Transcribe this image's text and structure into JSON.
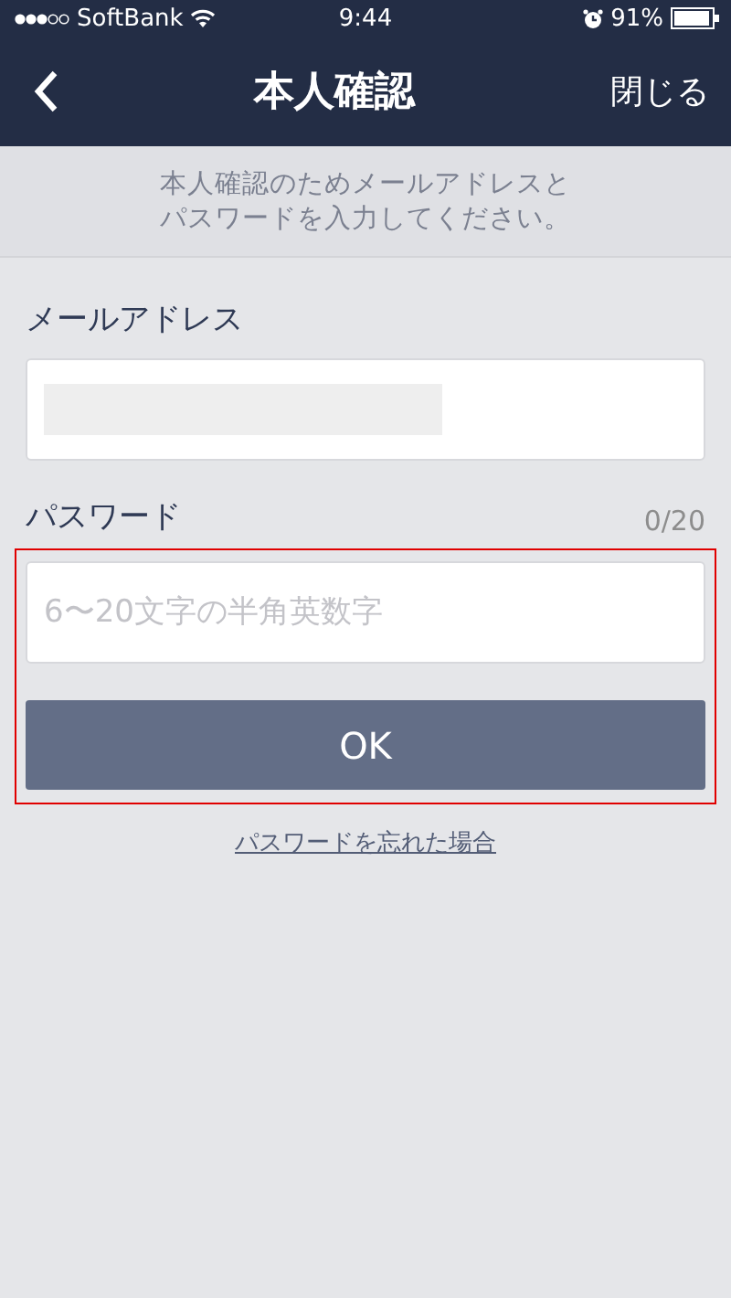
{
  "status_bar": {
    "carrier": "SoftBank",
    "time": "9:44",
    "battery": "91%"
  },
  "nav": {
    "title": "本人確認",
    "close": "閉じる"
  },
  "notice": "本人確認のためメールアドレスとパスワードを入力してください。",
  "email": {
    "label": "メールアドレス",
    "redacted": true
  },
  "password": {
    "label": "パスワード",
    "counter": "0/20",
    "placeholder": "6〜20文字の半角英数字",
    "highlighted": true
  },
  "ok_button": "OK",
  "forgot_link": "パスワードを忘れた場合"
}
